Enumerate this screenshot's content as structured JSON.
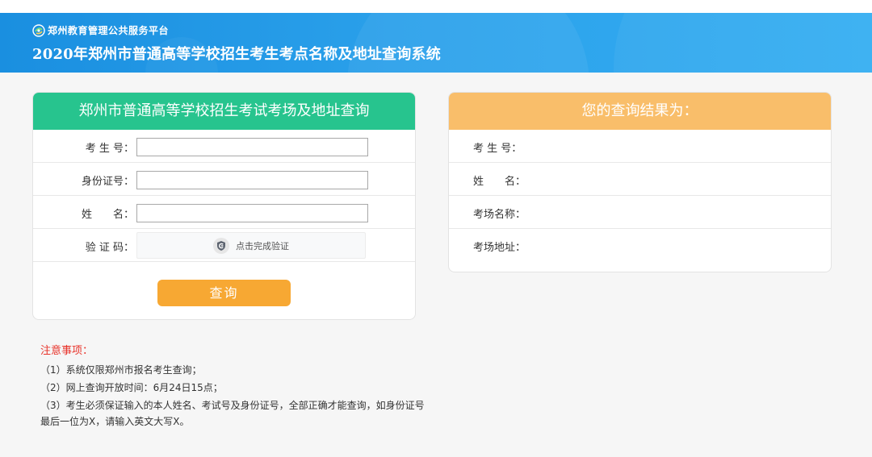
{
  "header": {
    "platform_name": "郑州教育管理公共服务平台",
    "system_title": "2020年郑州市普通高等学校招生考生考点名称及地址查询系统"
  },
  "query_panel": {
    "title": "郑州市普通高等学校招生考试考场及地址查询",
    "fields": {
      "exam_no_label": "考 生 号：",
      "exam_no_value": "",
      "id_label": "身份证号：",
      "id_value": "",
      "name_label": "姓　　名：",
      "name_value": "",
      "captcha_label": "验 证 码：",
      "captcha_text": "点击完成验证"
    },
    "submit_label": "查询"
  },
  "result_panel": {
    "title": "您的查询结果为：",
    "rows": [
      {
        "label": "考 生 号："
      },
      {
        "label": "姓　　名："
      },
      {
        "label": "考场名称："
      },
      {
        "label": "考场地址："
      }
    ]
  },
  "notes": {
    "title": "注意事项：",
    "items": [
      "（1）系统仅限郑州市报名考生查询；",
      "（2）网上查询开放时间：6月24日15点；",
      "（3）考生必须保证输入的本人姓名、考试号及身份证号，全部正确才能查询，如身份证号最后一位为X，请输入英文大写X。"
    ]
  },
  "colors": {
    "header_blue": "#1a8fe0",
    "query_green": "#27c48e",
    "result_orange": "#f9be6a",
    "button_orange": "#f7a833",
    "notes_red": "#e8332a"
  },
  "icons": {
    "logo": "platform-logo-icon",
    "captcha": "captcha-shield-icon"
  }
}
